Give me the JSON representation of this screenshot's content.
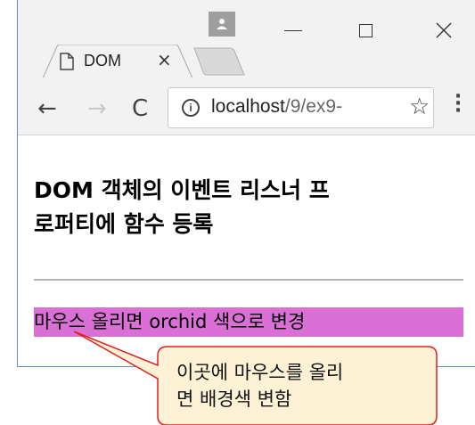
{
  "tab": {
    "title": "DOM",
    "close_glyph": "×"
  },
  "toolbar": {
    "url_host": "localhost",
    "url_rest": "/9/ex9-",
    "back_glyph": "←",
    "forward_glyph": "→",
    "reload_glyph": "C",
    "star_glyph": "☆",
    "info_glyph": "i",
    "menu_glyph": "⋮"
  },
  "window_controls": {
    "close_glyph": "✕"
  },
  "page": {
    "heading_line1": "DOM 객체의 이벤트 리스너 프",
    "heading_line2": "로퍼티에 함수 등록",
    "hover_text": "마우스 올리면 orchid 색으로 변경",
    "hover_bg": "#da70d6"
  },
  "callout": {
    "line1": "이곳에 마우스를 올리",
    "line2": "면 배경색 변함",
    "fill": "#fdf2d6",
    "stroke": "#e0201c"
  }
}
